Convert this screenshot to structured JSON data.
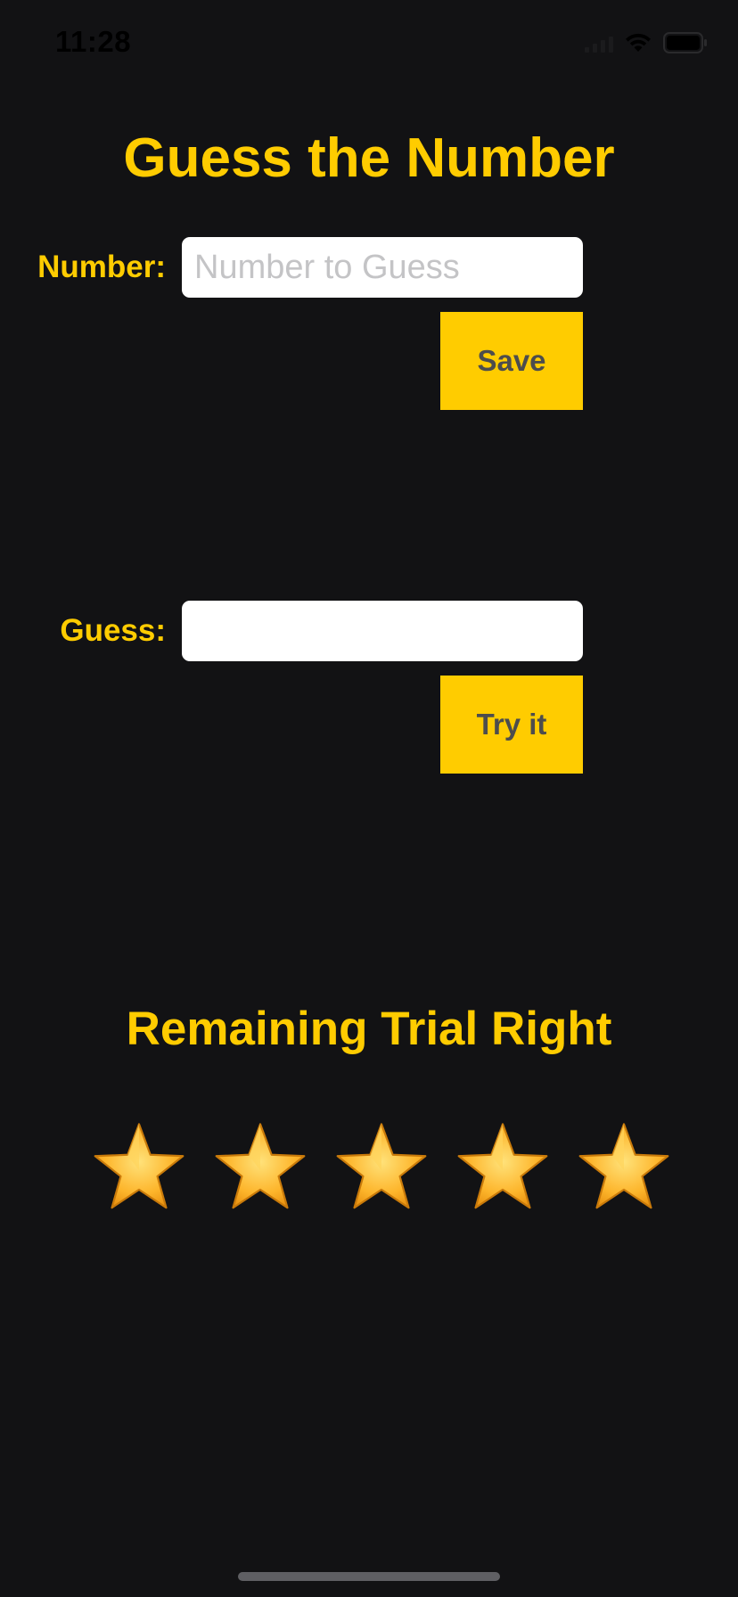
{
  "status_bar": {
    "time": "11:28"
  },
  "title": "Guess the Number",
  "number_field": {
    "label": "Number:",
    "placeholder": "Number to Guess",
    "value": ""
  },
  "save_button": {
    "label": "Save"
  },
  "guess_field": {
    "label": "Guess:",
    "placeholder": "",
    "value": ""
  },
  "try_button": {
    "label": "Try it"
  },
  "remaining": {
    "title": "Remaining Trial Right",
    "stars_remaining": 5,
    "star_icon": "star-icon"
  },
  "colors": {
    "background": "#121214",
    "accent": "#FFCC00",
    "button_text": "#4d4d4d",
    "input_background": "#ffffff"
  }
}
